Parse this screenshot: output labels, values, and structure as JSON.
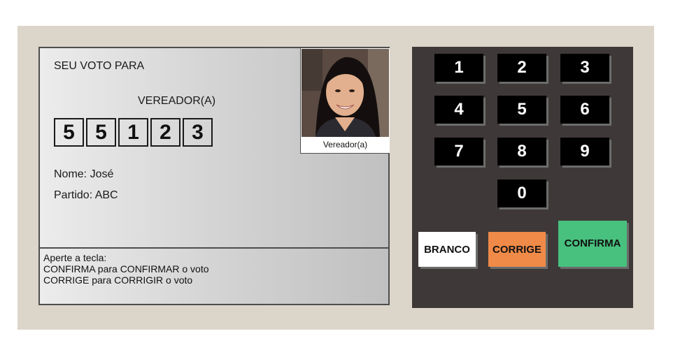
{
  "screen": {
    "title": "SEU VOTO PARA",
    "office": "VEREADOR(A)",
    "digits": [
      "5",
      "5",
      "1",
      "2",
      "3"
    ],
    "candidate_name": "Nome: José",
    "candidate_party": "Partido: ABC",
    "photo_caption": "Vereador(a)",
    "instructions": {
      "line1": "Aperte a tecla:",
      "line2": "CONFIRMA para CONFIRMAR o voto",
      "line3": "CORRIGE para CORRIGIR o voto"
    }
  },
  "keypad": {
    "keys": [
      "1",
      "2",
      "3",
      "4",
      "5",
      "6",
      "7",
      "8",
      "9",
      "0"
    ],
    "branco_label": "BRANCO",
    "corrige_label": "CORRIGE",
    "confirma_label": "CONFIRMA"
  },
  "colors": {
    "machine_bg": "#dcd5ca",
    "keypad_bg": "#3e3938",
    "branco": "#ffffff",
    "corrige": "#f08a48",
    "confirma": "#48c07e"
  }
}
